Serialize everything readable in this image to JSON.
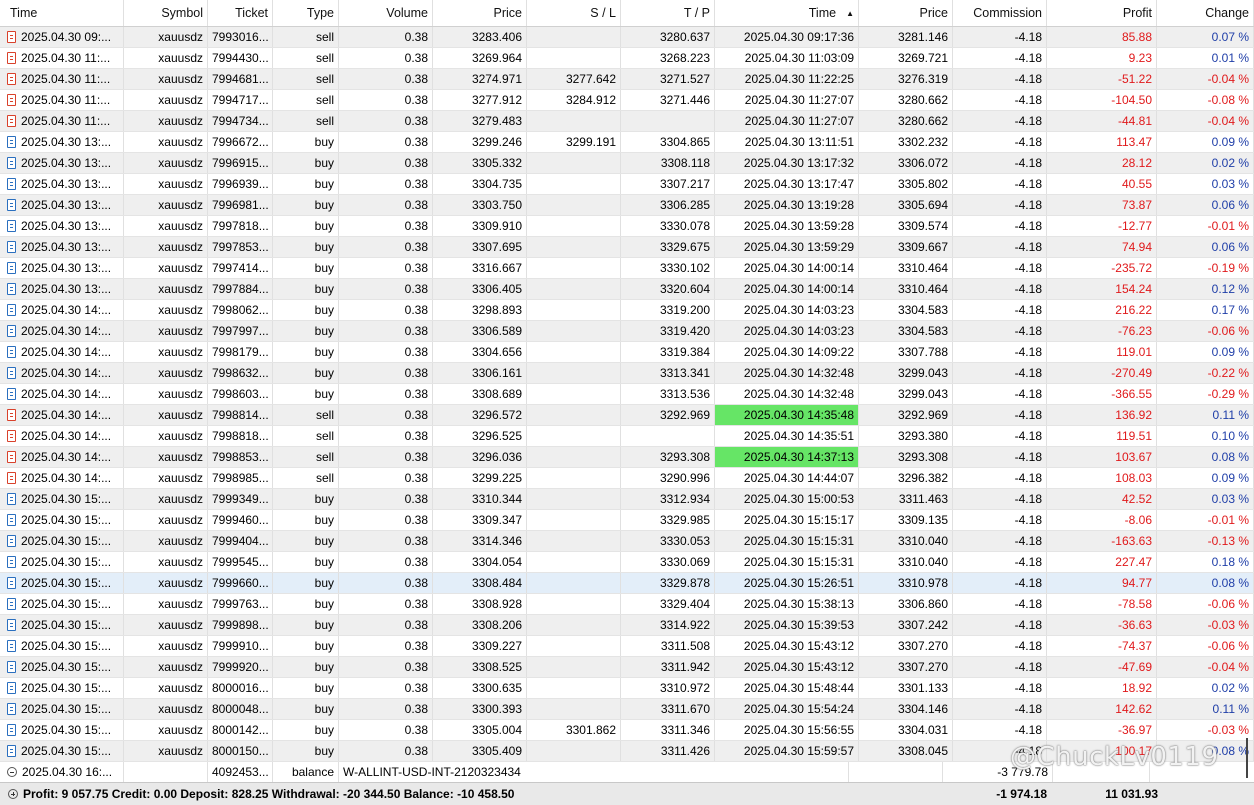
{
  "columns": [
    "Time",
    "Symbol",
    "Ticket",
    "Type",
    "Volume",
    "Price",
    "S / L",
    "T / P",
    "Time",
    "Price",
    "Commission",
    "Profit",
    "Change"
  ],
  "sort_indicator": "▲",
  "rows": [
    [
      "sell",
      "2025.04.30 09:...",
      "xauusdz",
      "7993016...",
      "sell",
      "0.38",
      "3283.406",
      "",
      "3280.637",
      "2025.04.30 09:17:36",
      "3281.146",
      "-4.18",
      "85.88",
      "0.07 %"
    ],
    [
      "sell",
      "2025.04.30 11:...",
      "xauusdz",
      "7994430...",
      "sell",
      "0.38",
      "3269.964",
      "",
      "3268.223",
      "2025.04.30 11:03:09",
      "3269.721",
      "-4.18",
      "9.23",
      "0.01 %"
    ],
    [
      "sell",
      "2025.04.30 11:...",
      "xauusdz",
      "7994681...",
      "sell",
      "0.38",
      "3274.971",
      "3277.642",
      "3271.527",
      "2025.04.30 11:22:25",
      "3276.319",
      "-4.18",
      "-51.22",
      "-0.04 %"
    ],
    [
      "sell",
      "2025.04.30 11:...",
      "xauusdz",
      "7994717...",
      "sell",
      "0.38",
      "3277.912",
      "3284.912",
      "3271.446",
      "2025.04.30 11:27:07",
      "3280.662",
      "-4.18",
      "-104.50",
      "-0.08 %"
    ],
    [
      "sell",
      "2025.04.30 11:...",
      "xauusdz",
      "7994734...",
      "sell",
      "0.38",
      "3279.483",
      "",
      "",
      "2025.04.30 11:27:07",
      "3280.662",
      "-4.18",
      "-44.81",
      "-0.04 %"
    ],
    [
      "buy",
      "2025.04.30 13:...",
      "xauusdz",
      "7996672...",
      "buy",
      "0.38",
      "3299.246",
      "3299.191",
      "3304.865",
      "2025.04.30 13:11:51",
      "3302.232",
      "-4.18",
      "113.47",
      "0.09 %"
    ],
    [
      "buy",
      "2025.04.30 13:...",
      "xauusdz",
      "7996915...",
      "buy",
      "0.38",
      "3305.332",
      "",
      "3308.118",
      "2025.04.30 13:17:32",
      "3306.072",
      "-4.18",
      "28.12",
      "0.02 %"
    ],
    [
      "buy",
      "2025.04.30 13:...",
      "xauusdz",
      "7996939...",
      "buy",
      "0.38",
      "3304.735",
      "",
      "3307.217",
      "2025.04.30 13:17:47",
      "3305.802",
      "-4.18",
      "40.55",
      "0.03 %"
    ],
    [
      "buy",
      "2025.04.30 13:...",
      "xauusdz",
      "7996981...",
      "buy",
      "0.38",
      "3303.750",
      "",
      "3306.285",
      "2025.04.30 13:19:28",
      "3305.694",
      "-4.18",
      "73.87",
      "0.06 %"
    ],
    [
      "buy",
      "2025.04.30 13:...",
      "xauusdz",
      "7997818...",
      "buy",
      "0.38",
      "3309.910",
      "",
      "3330.078",
      "2025.04.30 13:59:28",
      "3309.574",
      "-4.18",
      "-12.77",
      "-0.01 %"
    ],
    [
      "buy",
      "2025.04.30 13:...",
      "xauusdz",
      "7997853...",
      "buy",
      "0.38",
      "3307.695",
      "",
      "3329.675",
      "2025.04.30 13:59:29",
      "3309.667",
      "-4.18",
      "74.94",
      "0.06 %"
    ],
    [
      "buy",
      "2025.04.30 13:...",
      "xauusdz",
      "7997414...",
      "buy",
      "0.38",
      "3316.667",
      "",
      "3330.102",
      "2025.04.30 14:00:14",
      "3310.464",
      "-4.18",
      "-235.72",
      "-0.19 %"
    ],
    [
      "buy",
      "2025.04.30 13:...",
      "xauusdz",
      "7997884...",
      "buy",
      "0.38",
      "3306.405",
      "",
      "3320.604",
      "2025.04.30 14:00:14",
      "3310.464",
      "-4.18",
      "154.24",
      "0.12 %"
    ],
    [
      "buy",
      "2025.04.30 14:...",
      "xauusdz",
      "7998062...",
      "buy",
      "0.38",
      "3298.893",
      "",
      "3319.200",
      "2025.04.30 14:03:23",
      "3304.583",
      "-4.18",
      "216.22",
      "0.17 %"
    ],
    [
      "buy",
      "2025.04.30 14:...",
      "xauusdz",
      "7997997...",
      "buy",
      "0.38",
      "3306.589",
      "",
      "3319.420",
      "2025.04.30 14:03:23",
      "3304.583",
      "-4.18",
      "-76.23",
      "-0.06 %"
    ],
    [
      "buy",
      "2025.04.30 14:...",
      "xauusdz",
      "7998179...",
      "buy",
      "0.38",
      "3304.656",
      "",
      "3319.384",
      "2025.04.30 14:09:22",
      "3307.788",
      "-4.18",
      "119.01",
      "0.09 %"
    ],
    [
      "buy",
      "2025.04.30 14:...",
      "xauusdz",
      "7998632...",
      "buy",
      "0.38",
      "3306.161",
      "",
      "3313.341",
      "2025.04.30 14:32:48",
      "3299.043",
      "-4.18",
      "-270.49",
      "-0.22 %"
    ],
    [
      "buy",
      "2025.04.30 14:...",
      "xauusdz",
      "7998603...",
      "buy",
      "0.38",
      "3308.689",
      "",
      "3313.536",
      "2025.04.30 14:32:48",
      "3299.043",
      "-4.18",
      "-366.55",
      "-0.29 %"
    ],
    [
      "sell",
      "2025.04.30 14:...",
      "xauusdz",
      "7998814...",
      "sell",
      "0.38",
      "3296.572",
      "",
      "3292.969",
      "2025.04.30 14:35:48",
      "3292.969",
      "-4.18",
      "136.92",
      "0.11 %"
    ],
    [
      "sell",
      "2025.04.30 14:...",
      "xauusdz",
      "7998818...",
      "sell",
      "0.38",
      "3296.525",
      "",
      "",
      "2025.04.30 14:35:51",
      "3293.380",
      "-4.18",
      "119.51",
      "0.10 %"
    ],
    [
      "sell",
      "2025.04.30 14:...",
      "xauusdz",
      "7998853...",
      "sell",
      "0.38",
      "3296.036",
      "",
      "3293.308",
      "2025.04.30 14:37:13",
      "3293.308",
      "-4.18",
      "103.67",
      "0.08 %"
    ],
    [
      "sell",
      "2025.04.30 14:...",
      "xauusdz",
      "7998985...",
      "sell",
      "0.38",
      "3299.225",
      "",
      "3290.996",
      "2025.04.30 14:44:07",
      "3296.382",
      "-4.18",
      "108.03",
      "0.09 %"
    ],
    [
      "buy",
      "2025.04.30 15:...",
      "xauusdz",
      "7999349...",
      "buy",
      "0.38",
      "3310.344",
      "",
      "3312.934",
      "2025.04.30 15:00:53",
      "3311.463",
      "-4.18",
      "42.52",
      "0.03 %"
    ],
    [
      "buy",
      "2025.04.30 15:...",
      "xauusdz",
      "7999460...",
      "buy",
      "0.38",
      "3309.347",
      "",
      "3329.985",
      "2025.04.30 15:15:17",
      "3309.135",
      "-4.18",
      "-8.06",
      "-0.01 %"
    ],
    [
      "buy",
      "2025.04.30 15:...",
      "xauusdz",
      "7999404...",
      "buy",
      "0.38",
      "3314.346",
      "",
      "3330.053",
      "2025.04.30 15:15:31",
      "3310.040",
      "-4.18",
      "-163.63",
      "-0.13 %"
    ],
    [
      "buy",
      "2025.04.30 15:...",
      "xauusdz",
      "7999545...",
      "buy",
      "0.38",
      "3304.054",
      "",
      "3330.069",
      "2025.04.30 15:15:31",
      "3310.040",
      "-4.18",
      "227.47",
      "0.18 %"
    ],
    [
      "buy",
      "2025.04.30 15:...",
      "xauusdz",
      "7999660...",
      "buy",
      "0.38",
      "3308.484",
      "",
      "3329.878",
      "2025.04.30 15:26:51",
      "3310.978",
      "-4.18",
      "94.77",
      "0.08 %"
    ],
    [
      "buy",
      "2025.04.30 15:...",
      "xauusdz",
      "7999763...",
      "buy",
      "0.38",
      "3308.928",
      "",
      "3329.404",
      "2025.04.30 15:38:13",
      "3306.860",
      "-4.18",
      "-78.58",
      "-0.06 %"
    ],
    [
      "buy",
      "2025.04.30 15:...",
      "xauusdz",
      "7999898...",
      "buy",
      "0.38",
      "3308.206",
      "",
      "3314.922",
      "2025.04.30 15:39:53",
      "3307.242",
      "-4.18",
      "-36.63",
      "-0.03 %"
    ],
    [
      "buy",
      "2025.04.30 15:...",
      "xauusdz",
      "7999910...",
      "buy",
      "0.38",
      "3309.227",
      "",
      "3311.508",
      "2025.04.30 15:43:12",
      "3307.270",
      "-4.18",
      "-74.37",
      "-0.06 %"
    ],
    [
      "buy",
      "2025.04.30 15:...",
      "xauusdz",
      "7999920...",
      "buy",
      "0.38",
      "3308.525",
      "",
      "3311.942",
      "2025.04.30 15:43:12",
      "3307.270",
      "-4.18",
      "-47.69",
      "-0.04 %"
    ],
    [
      "buy",
      "2025.04.30 15:...",
      "xauusdz",
      "8000016...",
      "buy",
      "0.38",
      "3300.635",
      "",
      "3310.972",
      "2025.04.30 15:48:44",
      "3301.133",
      "-4.18",
      "18.92",
      "0.02 %"
    ],
    [
      "buy",
      "2025.04.30 15:...",
      "xauusdz",
      "8000048...",
      "buy",
      "0.38",
      "3300.393",
      "",
      "3311.670",
      "2025.04.30 15:54:24",
      "3304.146",
      "-4.18",
      "142.62",
      "0.11 %"
    ],
    [
      "buy",
      "2025.04.30 15:...",
      "xauusdz",
      "8000142...",
      "buy",
      "0.38",
      "3305.004",
      "3301.862",
      "3311.346",
      "2025.04.30 15:56:55",
      "3304.031",
      "-4.18",
      "-36.97",
      "-0.03 %"
    ],
    [
      "buy",
      "2025.04.30 15:...",
      "xauusdz",
      "8000150...",
      "buy",
      "0.38",
      "3305.409",
      "",
      "3311.426",
      "2025.04.30 15:59:57",
      "3308.045",
      "-4.18",
      "100.17",
      "0.08 %"
    ]
  ],
  "selected_row": 26,
  "tp_highlight_rows": [
    18,
    20
  ],
  "highlight_color": "#66e566",
  "balance_row": {
    "time": "2025.04.30 16:...",
    "ticket": "4092453...",
    "type": "balance",
    "comment": "W-ALLINT-USD-INT-2120323434",
    "profit": "-3 779.78"
  },
  "footer": {
    "summary": "Profit: 9 057.75  Credit: 0.00  Deposit: 828.25  Withdrawal: -20 344.50  Balance: -10 458.50",
    "commission_total": "-1 974.18",
    "profit_total": "11 031.93"
  },
  "watermark": "@ChuckLv0119",
  "colors": {
    "negative": "#e0191b",
    "positive": "#1f3ea8",
    "selected": "#e3eef9",
    "alt_row": "#efefef"
  }
}
